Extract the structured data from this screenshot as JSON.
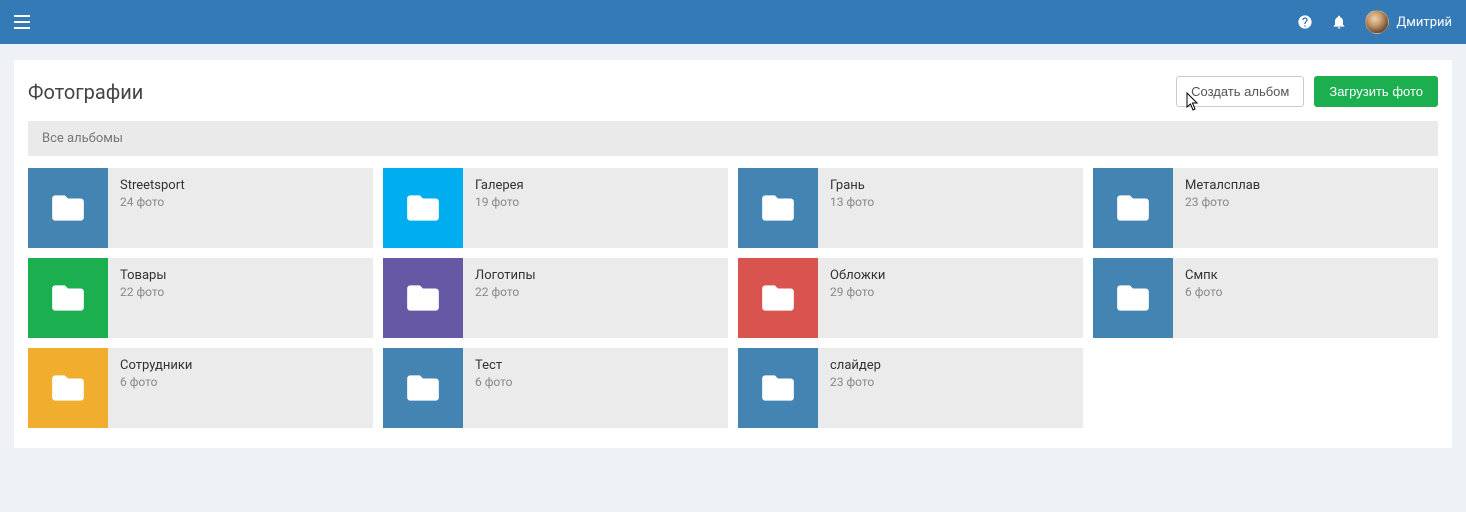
{
  "header": {
    "user_name": "Дмитрий"
  },
  "page": {
    "title": "Фотографии",
    "breadcrumb": "Все альбомы",
    "btn_create": "Создать альбом",
    "btn_upload": "Загрузить фото"
  },
  "colors": {
    "blue": "#4484b3",
    "cyan": "#00aeef",
    "green": "#1caf50",
    "purple": "#6658a5",
    "red": "#d9534f",
    "orange": "#f0ad2e"
  },
  "albums": [
    {
      "title": "Streetsport",
      "count": "24 фото",
      "color": "blue"
    },
    {
      "title": "Галерея",
      "count": "19 фото",
      "color": "cyan"
    },
    {
      "title": "Грань",
      "count": "13 фото",
      "color": "blue"
    },
    {
      "title": "Металсплав",
      "count": "23 фото",
      "color": "blue"
    },
    {
      "title": "Товары",
      "count": "22 фото",
      "color": "green"
    },
    {
      "title": "Логотипы",
      "count": "22 фото",
      "color": "purple"
    },
    {
      "title": "Обложки",
      "count": "29 фото",
      "color": "red"
    },
    {
      "title": "Смпк",
      "count": "6 фото",
      "color": "blue"
    },
    {
      "title": "Сотрудники",
      "count": "6 фото",
      "color": "orange"
    },
    {
      "title": "Тест",
      "count": "6 фото",
      "color": "blue"
    },
    {
      "title": "слайдер",
      "count": "23 фото",
      "color": "blue"
    }
  ]
}
